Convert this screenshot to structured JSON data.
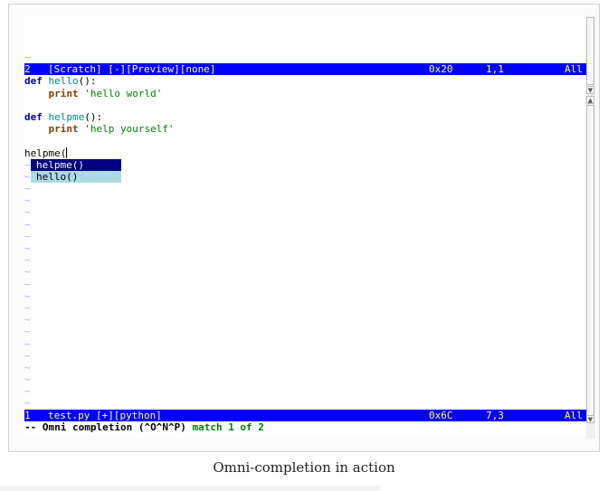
{
  "editor": {
    "top_tilde": "~",
    "preview_status": {
      "buffer_num": "2",
      "name": "[Scratch] [-][Preview][none]",
      "byte": "0x20",
      "position": "1,1",
      "percent": "All"
    },
    "code_lines": [
      {
        "kw": "def",
        "name": "hello",
        "rest": "():"
      },
      {
        "indent": "    ",
        "stmt": "print",
        "str": "'hello world'"
      },
      {
        "blank": true
      },
      {
        "kw": "def",
        "name": "helpme",
        "rest": "():"
      },
      {
        "indent": "    ",
        "stmt": "print",
        "str": "'help yourself'"
      },
      {
        "blank": true
      }
    ],
    "typed_text": "helpme(",
    "completion_popup": {
      "items": [
        "helpme()",
        "hello()"
      ],
      "selected_index": 0
    },
    "tilde_char": "~",
    "main_status": {
      "buffer_num": "1",
      "name": "test.py [+][python]",
      "byte": "0x6C",
      "position": "7,3",
      "percent": "All"
    },
    "modeline": {
      "prefix": "-- ",
      "mode": "Omni completion (^O^N^P)",
      "match": "match 1 of 2"
    }
  },
  "caption": "Omni-completion in action",
  "colors": {
    "status_bg": "#0000ff",
    "status_fg": "#ffff55",
    "popup_selected_bg": "#000080",
    "popup_bg": "#add8e6",
    "tilde": "#a8a8ff"
  }
}
